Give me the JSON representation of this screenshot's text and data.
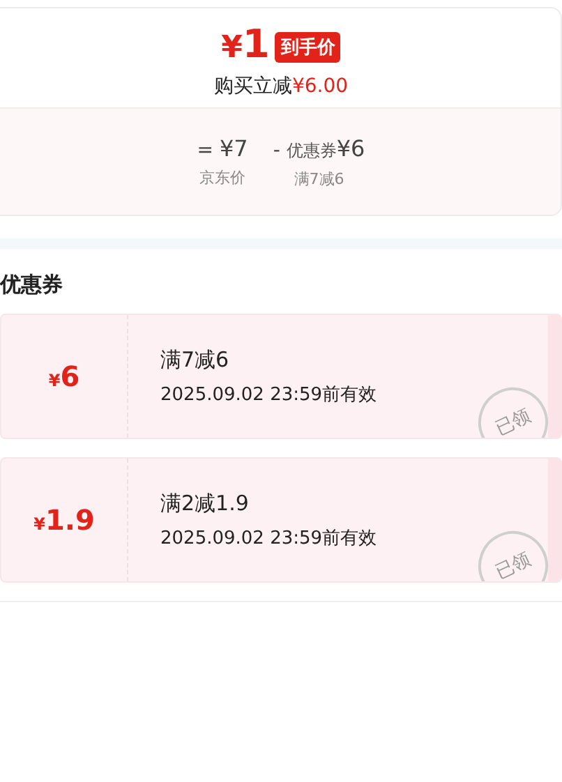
{
  "price_card": {
    "currency": "¥",
    "price": "1",
    "badge": "到手价",
    "discount_label": "购买立减",
    "discount_value": "¥6.00",
    "formula": [
      {
        "operator": "=",
        "currency": "¥",
        "amount": "7",
        "caption": "京东价"
      },
      {
        "operator": "-",
        "currency": "¥",
        "label": "优惠券",
        "amount": "6",
        "caption": "满7减6"
      }
    ]
  },
  "coupons_section": {
    "title": "优惠券",
    "coupons": [
      {
        "currency": "¥",
        "amount": "6",
        "condition": "满7减6",
        "validity": "2025.09.02 23:59前有效",
        "stamp": "已领"
      },
      {
        "currency": "¥",
        "amount": "1.9",
        "condition": "满2减1.9",
        "validity": "2025.09.02 23:59前有效",
        "stamp": "已领"
      }
    ]
  }
}
